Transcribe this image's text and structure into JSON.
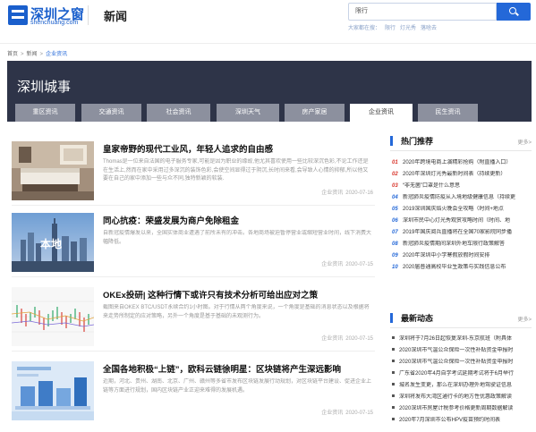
{
  "header": {
    "logo_cn": "深圳之窗",
    "logo_en": "shenchuang.com",
    "section_title": "新闻",
    "search_value": "限行",
    "hot_label": "大家都在搜：",
    "hot_searches": [
      "限行",
      "灯光秀",
      "落啥去"
    ]
  },
  "breadcrumb": [
    "首页",
    "新闻",
    "企业资讯"
  ],
  "banner": {
    "title": "深圳城事",
    "tabs": [
      "重区资讯",
      "交通资讯",
      "社会资讯",
      "深圳天气",
      "房产家居",
      "企业资讯",
      "民生资讯"
    ],
    "active_tab": "企业资讯"
  },
  "articles": [
    {
      "title": "皇家帝野的现代工业风，年轻人追求的自由感",
      "desc": "Thomas是一位来自法国的电子服务专家,可能是因为职业的缘故,他尤其喜欢使用一些比较深沉色彩,不论工作还是在生活上,然而在家中采用过多深沉的装饰色彩,会使空间显得过于阴沉,长时间来看,会导致人心情的抑郁,所以他又要在自己的家中添加一些与众不同,独特新颖的软装.",
      "source": "企业资讯",
      "date": "2020-07-16"
    },
    {
      "title": "同心抗疫：荣盛发展为商户免除租金",
      "thumb_label": "本地",
      "desc": "自新冠疫情爆发以来，全国实体商业遭遇了前所未有的冲击。各地商场被迫暂停营业或缩短营业时间，线下消费大幅降低。",
      "source": "企业资讯",
      "date": "2020-07-15"
    },
    {
      "title": "OKEx投研| 这种行情下或许只有技术分析可给出应对之策",
      "desc": "截图来自OKEX BTC/USDT永续合约1小时图。对于行情从两个角度来说，一个角度是基础的消息状态以及根据将来走势所制定的应对策略，另外一个角度是基于基础的未观测行为。",
      "source": "企业资讯",
      "date": "2020-07-15"
    },
    {
      "title": "全国各地积极“上链”，欧科云链徐明星：区块链将产生深远影响",
      "desc": "近期，河北、贵州、湖南、北京、广州、赣州等多省市发布区块链发展行动规划，对区块链平台建设、促进企业上链等方面进行规划，国内区块链产业正迎来难得的发展机遇。",
      "source": "企业资讯",
      "date": "2020-07-15"
    }
  ],
  "sidebar": {
    "hot": {
      "title": "热门推荐",
      "more": "更多>",
      "items": [
        {
          "n": "01",
          "text": "2020年跨境电商上演精彩抢购（附直播入口）"
        },
        {
          "n": "02",
          "text": "2020年深圳灯光秀最新时间表（持续更新）"
        },
        {
          "n": "03",
          "text": "“非无菌”口罩是什么意思"
        },
        {
          "n": "04",
          "text": "新冠肺炎疫情防疫从入境地级健康信息（持续更"
        },
        {
          "n": "05",
          "text": "2019深圳国庆焰火晚会全攻略（时间+地点"
        },
        {
          "n": "06",
          "text": "深圳市民中心灯光秀观赏攻略时间（时间、地"
        },
        {
          "n": "07",
          "text": "2019年国庆阅兵直播将在全国70家影院同步播"
        },
        {
          "n": "08",
          "text": "新冠肺炎疫情期间深圳外地车限行政策解答"
        },
        {
          "n": "09",
          "text": "2020年深圳中小学寒假放假时间安排"
        },
        {
          "n": "10",
          "text": "2020届普通高校毕业生政策与实践信息公布"
        }
      ]
    },
    "news": {
      "title": "最新动态",
      "more": "更多>",
      "items": [
        "深圳将于7月26日起恢复深圳-东京航班（附具体",
        "2020深圳市气温公众保险一次性补贴资金申报时",
        "2020深圳市气温公众保险一次性补贴资金申报时",
        "广东省2020年4月自学考试延期考试将于6月举行",
        "城名发生变更，那么在深圳办理外地驾驶证信息",
        "深圳将发布大湾区通行卡的地方性优惠政策解读",
        "2020深圳市房屋计税参考价格更新周期数据解读",
        "2020年7月深圳市公布HPV疫苗预约时间表"
      ]
    }
  }
}
